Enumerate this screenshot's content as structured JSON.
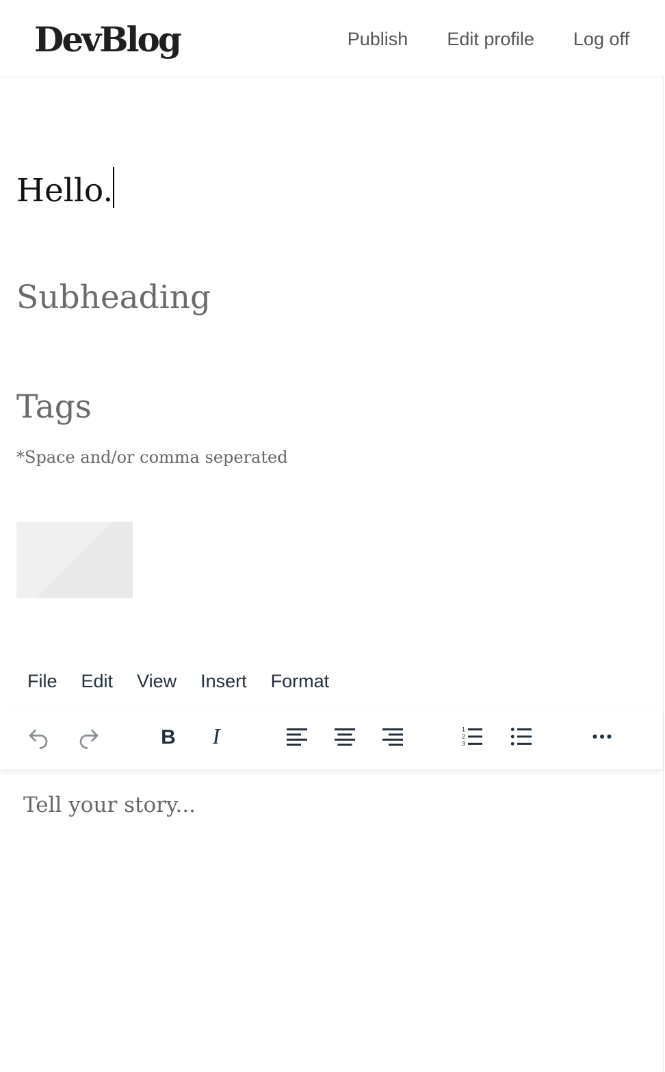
{
  "header": {
    "logo": "DevBlog",
    "nav": {
      "publish": "Publish",
      "edit_profile": "Edit profile",
      "log_off": "Log off"
    }
  },
  "post": {
    "title_value": "Hello.",
    "subheading_placeholder": "Subheading",
    "tags_placeholder": "Tags",
    "tags_hint": "*Space and/or comma seperated"
  },
  "editor": {
    "menu": {
      "file": "File",
      "edit": "Edit",
      "view": "View",
      "insert": "Insert",
      "format": "Format"
    },
    "toolbar_icons": [
      "undo-icon",
      "redo-icon",
      "bold-icon",
      "italic-icon",
      "align-left-icon",
      "align-center-icon",
      "align-right-icon",
      "numbered-list-icon",
      "bulleted-list-icon",
      "more-icon"
    ],
    "body_placeholder": "Tell your story..."
  },
  "colors": {
    "text_dark": "#222f3e",
    "placeholder_gray": "#6a6a6a",
    "disabled_icon": "#8a8f96"
  }
}
